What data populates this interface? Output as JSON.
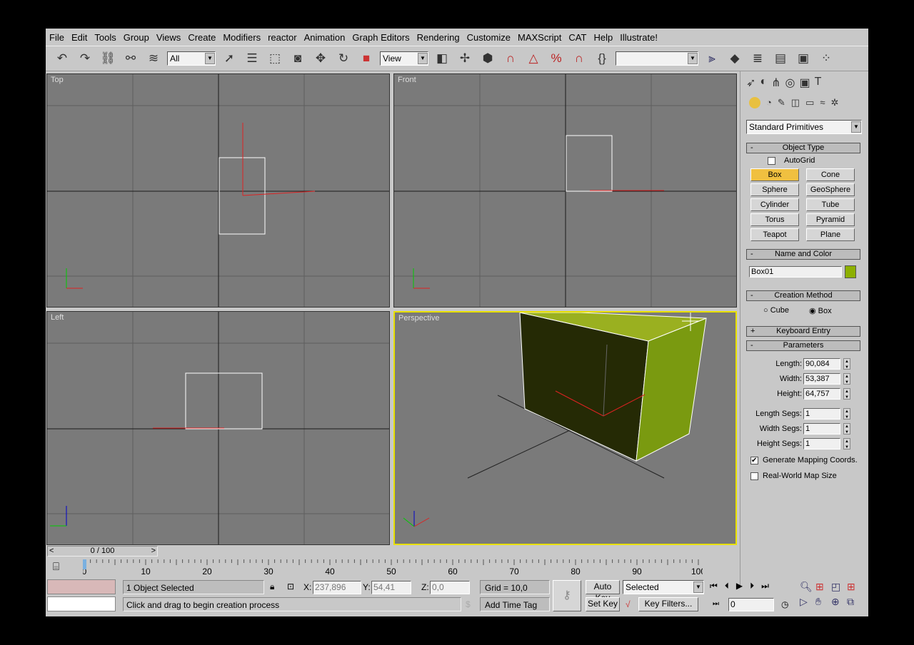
{
  "menu": [
    "File",
    "Edit",
    "Tools",
    "Group",
    "Views",
    "Create",
    "Modifiers",
    "reactor",
    "Animation",
    "Graph Editors",
    "Rendering",
    "Customize",
    "MAXScript",
    "CAT",
    "Help",
    "Illustrate!"
  ],
  "toolbar": {
    "selection_filter": "All",
    "ref_coord": "View",
    "named_selection": ""
  },
  "viewports": [
    {
      "label": "Top"
    },
    {
      "label": "Front"
    },
    {
      "label": "Left"
    },
    {
      "label": "Perspective"
    }
  ],
  "axes": {
    "x": "x",
    "y": "y",
    "z": "z"
  },
  "command_panel": {
    "category": "Standard Primitives",
    "object_type": {
      "title": "Object Type",
      "autogrid": "AutoGrid",
      "buttons": [
        "Box",
        "Cone",
        "Sphere",
        "GeoSphere",
        "Cylinder",
        "Tube",
        "Torus",
        "Pyramid",
        "Teapot",
        "Plane"
      ],
      "active": "Box"
    },
    "name_color": {
      "title": "Name and Color",
      "name": "Box01",
      "color": "#8db000"
    },
    "creation": {
      "title": "Creation Method",
      "cube": "Cube",
      "box": "Box",
      "selected": "Box"
    },
    "keyboard": {
      "title": "Keyboard Entry"
    },
    "params": {
      "title": "Parameters",
      "fields": [
        {
          "label": "Length:",
          "value": "90,084"
        },
        {
          "label": "Width:",
          "value": "53,387"
        },
        {
          "label": "Height:",
          "value": "64,757"
        },
        {
          "label": "Length Segs:",
          "value": "1"
        },
        {
          "label": "Width Segs:",
          "value": "1"
        },
        {
          "label": "Height Segs:",
          "value": "1"
        }
      ],
      "gen_mapping": "Generate Mapping Coords.",
      "gen_mapping_checked": true,
      "real_world": "Real-World Map Size",
      "real_world_checked": false
    }
  },
  "timeline": {
    "frame": "0 / 100",
    "ticks": [
      "0",
      "10",
      "20",
      "30",
      "40",
      "50",
      "60",
      "70",
      "80",
      "90",
      "100"
    ],
    "progress": 0
  },
  "status": {
    "selected": "1 Object Selected",
    "prompt": "Click and drag to begin creation process",
    "x_label": "X:",
    "x": "237,896",
    "y_label": "Y:",
    "y": "54,41",
    "z_label": "Z:",
    "z": "0,0",
    "grid": "Grid = 10,0",
    "time_tag": "Add Time Tag",
    "auto_key": "Auto Key",
    "set_key": "Set Key",
    "key_mode": "Selected",
    "key_filters": "Key Filters...",
    "current_frame": "0"
  }
}
